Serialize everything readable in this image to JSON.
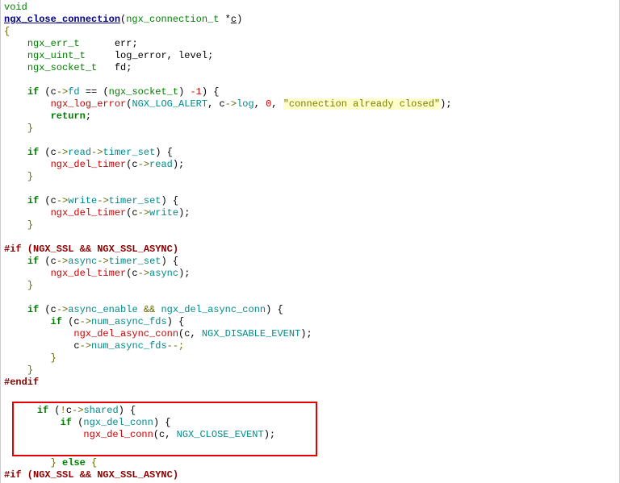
{
  "l1": "void",
  "funcname": "ngx_close_connection",
  "sig_type": "ngx_connection_t",
  "sig_star": " *",
  "sig_param": "c",
  "decl1_t": "ngx_err_t",
  "decl1_v": "err;",
  "decl2_t": "ngx_uint_t",
  "decl2_v": "log_error, level;",
  "decl3_t": "ngx_socket_t",
  "decl3_v": "fd;",
  "if1_kw": "if",
  "if1_expr_c": "c",
  "if1_arrow": "->",
  "if1_fd": "fd",
  "if1_eq": " == (",
  "if1_cast": "ngx_socket_t",
  "if1_close": ") ",
  "if1_neg1": "-1",
  "if1_end": ") {",
  "logcall": "ngx_log_error",
  "logcall_open": "(",
  "logcall_a1": "NGX_LOG_ALERT",
  "logcall_sep1": ", ",
  "logcall_c": "c",
  "logcall_arrow": "->",
  "logcall_log": "log",
  "logcall_sep2": ", ",
  "logcall_zero": "0",
  "logcall_sep3": ", ",
  "logcall_str": "\"connection already closed\"",
  "logcall_end": ");",
  "return_kw": "return",
  "semicolon": ";",
  "rbrace": "}",
  "lbrace": "{",
  "if2_read": "read",
  "timer_set": "timer_set",
  "deltimer": "ngx_del_timer",
  "if3_write": "write",
  "preproc_if": "#if (NGX_SSL && NGX_SSL_ASYNC)",
  "async": "async",
  "async_enable": "async_enable",
  "and_op": " && ",
  "del_async": "ngx_del_async_conn",
  "num_async_fds": "num_async_fds",
  "disable_event": "NGX_DISABLE_EVENT",
  "decdec": "--;",
  "endif": "#endif",
  "not_op": "!",
  "shared": "shared",
  "del_conn": "ngx_del_conn",
  "close_event": "NGX_CLOSE_EVENT",
  "else_kw": "else",
  "sp4": "    ",
  "sp8": "        ",
  "sp12": "            "
}
